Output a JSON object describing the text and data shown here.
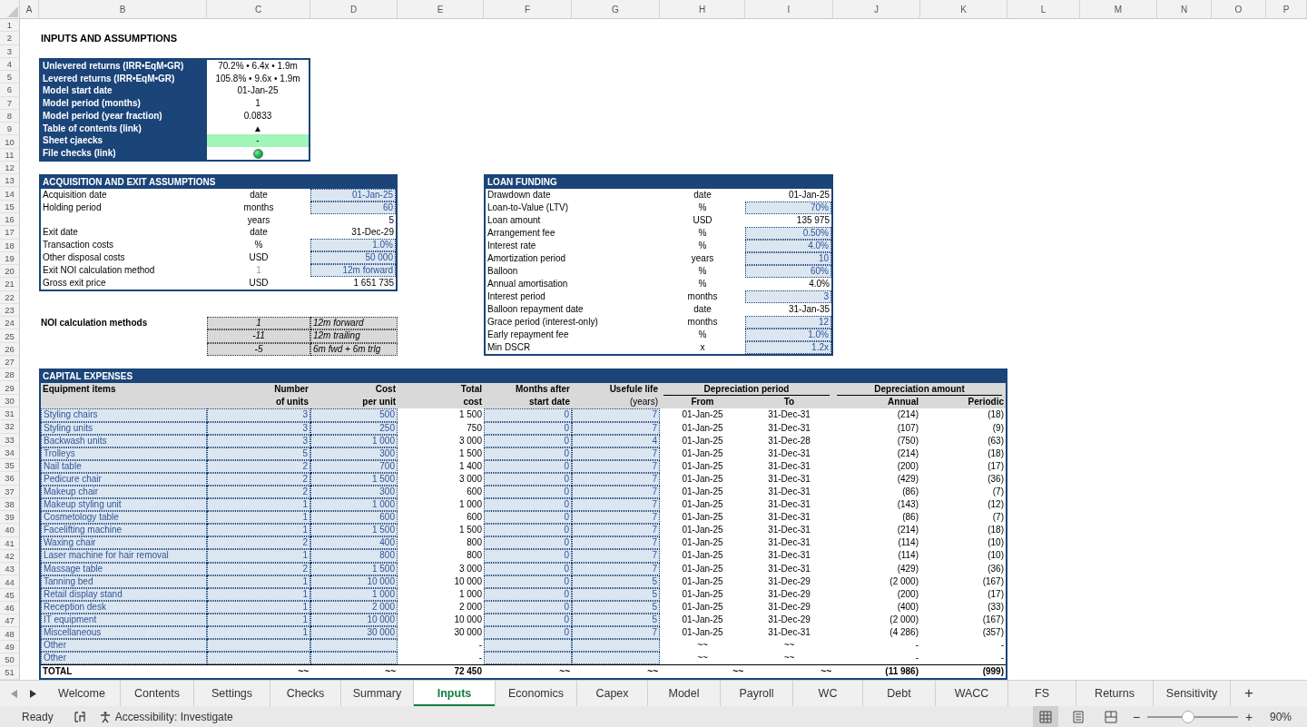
{
  "columns": [
    "A",
    "B",
    "C",
    "D",
    "E",
    "F",
    "G",
    "H",
    "I",
    "J",
    "K",
    "L",
    "M",
    "N",
    "O",
    "P"
  ],
  "rows": [
    "1",
    "2",
    "3",
    "4",
    "5",
    "6",
    "7",
    "8",
    "9",
    "10",
    "11",
    "12",
    "13",
    "14",
    "15",
    "16",
    "17",
    "18",
    "19",
    "20",
    "21",
    "22",
    "23",
    "24",
    "25",
    "26",
    "27",
    "28",
    "29",
    "30",
    "31",
    "32",
    "33",
    "34",
    "35",
    "36",
    "37",
    "38",
    "39",
    "40",
    "41",
    "42",
    "43",
    "44",
    "45",
    "46",
    "47",
    "48",
    "49",
    "50",
    "51"
  ],
  "title": "INPUTS AND ASSUMPTIONS",
  "summary": [
    {
      "label": "Unlevered returns (IRR•EqM•GR)",
      "kind": "text",
      "value": "70.2% • 6.4x • 1.9m"
    },
    {
      "label": "Levered returns (IRR•EqM•GR)",
      "kind": "text",
      "value": "105.8% • 9.6x • 1.9m"
    },
    {
      "label": "Model start date",
      "kind": "text",
      "value": "01-Jan-25"
    },
    {
      "label": "Model period (months)",
      "kind": "text",
      "value": "1"
    },
    {
      "label": "Model period (year fraction)",
      "kind": "text",
      "value": "0.0833"
    },
    {
      "label": "Table of contents (link)",
      "kind": "text",
      "value": "▲"
    },
    {
      "label": "Sheet cjaecks",
      "kind": "status",
      "value": "-",
      "ok": true
    },
    {
      "label": "File checks (link)",
      "kind": "indicator",
      "ok": true
    }
  ],
  "acquisition": {
    "title": "ACQUISITION AND EXIT ASSUMPTIONS",
    "rows": [
      {
        "label": "Acquisition date",
        "unit": "date",
        "unit_dim": false,
        "value": "01-Jan-25",
        "input": true
      },
      {
        "label": "Holding period",
        "unit": "months",
        "unit_dim": false,
        "value": "60",
        "input": true
      },
      {
        "unit": "years",
        "unit_dim": false,
        "value": "5",
        "input": false
      },
      {
        "label": "Exit date",
        "unit": "date",
        "unit_dim": false,
        "value": "31-Dec-29",
        "input": false
      },
      {
        "label": "Transaction costs",
        "unit": "%",
        "unit_dim": false,
        "value": "1.0%",
        "input": true
      },
      {
        "label": "Other disposal costs",
        "unit": "USD",
        "unit_dim": false,
        "value": "50 000",
        "input": true
      },
      {
        "label": "Exit NOI calculation method",
        "unit": "1",
        "unit_dim": true,
        "value": "12m forward",
        "input": true
      },
      {
        "label": "Gross exit price",
        "unit": "USD",
        "unit_dim": false,
        "value": "1 651 735",
        "input": false
      }
    ]
  },
  "noi_methods": {
    "label": "NOI calculation methods",
    "rows": [
      {
        "code": "1",
        "name": "12m forward"
      },
      {
        "code": "-11",
        "name": "12m trailing"
      },
      {
        "code": "-5",
        "name": "6m fwd + 6m trlg"
      }
    ]
  },
  "loan": {
    "title": "LOAN FUNDING",
    "rows": [
      {
        "label": "Drawdown date",
        "unit": "date",
        "value": "01-Jan-25",
        "input": false
      },
      {
        "label": "Loan-to-Value (LTV)",
        "unit": "%",
        "value": "70%",
        "input": true
      },
      {
        "label": "Loan amount",
        "unit": "USD",
        "value": "135 975",
        "input": false
      },
      {
        "label": "Arrangement fee",
        "unit": "%",
        "value": "0.50%",
        "input": true
      },
      {
        "label": "Interest rate",
        "unit": "%",
        "value": "4.0%",
        "input": true
      },
      {
        "label": "Amortization period",
        "unit": "years",
        "value": "10",
        "input": true
      },
      {
        "label": "Balloon",
        "unit": "%",
        "value": "60%",
        "input": true
      },
      {
        "label": "Annual amortisation",
        "unit": "%",
        "value": "4.0%",
        "input": false
      },
      {
        "label": "Interest period",
        "unit": "months",
        "value": "3",
        "input": true
      },
      {
        "label": "Balloon repayment date",
        "unit": "date",
        "value": "31-Jan-35",
        "input": false
      },
      {
        "label": "Grace period (interest-only)",
        "unit": "months",
        "value": "12",
        "input": true
      },
      {
        "label": "Early repayment fee",
        "unit": "%",
        "value": "1.0%",
        "input": true
      },
      {
        "label": "Min DSCR",
        "unit": "x",
        "value": "1.2x",
        "input": true
      }
    ]
  },
  "capex": {
    "title": "CAPITAL EXPENSES",
    "columns": [
      {
        "top": "Equipment items"
      },
      {
        "top": "Number",
        "bottom": "of units"
      },
      {
        "top": "Cost",
        "bottom": "per unit"
      },
      {
        "top": "Total",
        "bottom": "cost"
      },
      {
        "top": "Months after",
        "bottom": "start date"
      },
      {
        "top": "Usefule life",
        "bottom": "(years)"
      },
      {
        "bottom": "From"
      },
      {
        "bottom": "To"
      },
      {
        "bottom": "Annual"
      },
      {
        "bottom": "Periodic"
      }
    ],
    "groups": [
      "Depreciation period",
      "Depreciation amount"
    ],
    "items": [
      {
        "item": "Styling chairs",
        "units": "3",
        "cost": "500",
        "total": "1 500",
        "months": "0",
        "life": "7",
        "from": "01-Jan-25",
        "to": "31-Dec-31",
        "annual": "(214)",
        "periodic": "(18)"
      },
      {
        "item": "Styling units",
        "units": "3",
        "cost": "250",
        "total": "750",
        "months": "0",
        "life": "7",
        "from": "01-Jan-25",
        "to": "31-Dec-31",
        "annual": "(107)",
        "periodic": "(9)"
      },
      {
        "item": "Backwash units",
        "units": "3",
        "cost": "1 000",
        "total": "3 000",
        "months": "0",
        "life": "4",
        "from": "01-Jan-25",
        "to": "31-Dec-28",
        "annual": "(750)",
        "periodic": "(63)"
      },
      {
        "item": "Trolleys",
        "units": "5",
        "cost": "300",
        "total": "1 500",
        "months": "0",
        "life": "7",
        "from": "01-Jan-25",
        "to": "31-Dec-31",
        "annual": "(214)",
        "periodic": "(18)"
      },
      {
        "item": "Nail table",
        "units": "2",
        "cost": "700",
        "total": "1 400",
        "months": "0",
        "life": "7",
        "from": "01-Jan-25",
        "to": "31-Dec-31",
        "annual": "(200)",
        "periodic": "(17)"
      },
      {
        "item": "Pedicure chair",
        "units": "2",
        "cost": "1 500",
        "total": "3 000",
        "months": "0",
        "life": "7",
        "from": "01-Jan-25",
        "to": "31-Dec-31",
        "annual": "(429)",
        "periodic": "(36)"
      },
      {
        "item": "Makeup chair",
        "units": "2",
        "cost": "300",
        "total": "600",
        "months": "0",
        "life": "7",
        "from": "01-Jan-25",
        "to": "31-Dec-31",
        "annual": "(86)",
        "periodic": "(7)"
      },
      {
        "item": "Makeup styling unit",
        "units": "1",
        "cost": "1 000",
        "total": "1 000",
        "months": "0",
        "life": "7",
        "from": "01-Jan-25",
        "to": "31-Dec-31",
        "annual": "(143)",
        "periodic": "(12)"
      },
      {
        "item": "Cosmetology table",
        "units": "1",
        "cost": "600",
        "total": "600",
        "months": "0",
        "life": "7",
        "from": "01-Jan-25",
        "to": "31-Dec-31",
        "annual": "(86)",
        "periodic": "(7)"
      },
      {
        "item": "Facelifting machine",
        "units": "1",
        "cost": "1 500",
        "total": "1 500",
        "months": "0",
        "life": "7",
        "from": "01-Jan-25",
        "to": "31-Dec-31",
        "annual": "(214)",
        "periodic": "(18)"
      },
      {
        "item": "Waxing chair",
        "units": "2",
        "cost": "400",
        "total": "800",
        "months": "0",
        "life": "7",
        "from": "01-Jan-25",
        "to": "31-Dec-31",
        "annual": "(114)",
        "periodic": "(10)"
      },
      {
        "item": "Laser machine for hair removal",
        "units": "1",
        "cost": "800",
        "total": "800",
        "months": "0",
        "life": "7",
        "from": "01-Jan-25",
        "to": "31-Dec-31",
        "annual": "(114)",
        "periodic": "(10)"
      },
      {
        "item": "Massage table",
        "units": "2",
        "cost": "1 500",
        "total": "3 000",
        "months": "0",
        "life": "7",
        "from": "01-Jan-25",
        "to": "31-Dec-31",
        "annual": "(429)",
        "periodic": "(36)"
      },
      {
        "item": "Tanning bed",
        "units": "1",
        "cost": "10 000",
        "total": "10 000",
        "months": "0",
        "life": "5",
        "from": "01-Jan-25",
        "to": "31-Dec-29",
        "annual": "(2 000)",
        "periodic": "(167)"
      },
      {
        "item": "Retail display stand",
        "units": "1",
        "cost": "1 000",
        "total": "1 000",
        "months": "0",
        "life": "5",
        "from": "01-Jan-25",
        "to": "31-Dec-29",
        "annual": "(200)",
        "periodic": "(17)"
      },
      {
        "item": "Reception desk",
        "units": "1",
        "cost": "2 000",
        "total": "2 000",
        "months": "0",
        "life": "5",
        "from": "01-Jan-25",
        "to": "31-Dec-29",
        "annual": "(400)",
        "periodic": "(33)"
      },
      {
        "item": "IT equipment",
        "units": "1",
        "cost": "10 000",
        "total": "10 000",
        "months": "0",
        "life": "5",
        "from": "01-Jan-25",
        "to": "31-Dec-29",
        "annual": "(2 000)",
        "periodic": "(167)"
      },
      {
        "item": "Miscellaneous",
        "units": "1",
        "cost": "30 000",
        "total": "30 000",
        "months": "0",
        "life": "7",
        "from": "01-Jan-25",
        "to": "31-Dec-31",
        "annual": "(4 286)",
        "periodic": "(357)"
      },
      {
        "item": "Other",
        "total": "-",
        "from": "~~",
        "to": "~~",
        "annual": "-",
        "periodic": "-"
      },
      {
        "item": "Other",
        "total": "-",
        "from": "~~",
        "to": "~~",
        "annual": "-",
        "periodic": "-"
      }
    ],
    "total": {
      "item": "TOTAL",
      "units": "~~",
      "cost": "~~",
      "total": "72 450",
      "months": "~~",
      "life": "~~",
      "from": "~~",
      "to": "~~",
      "annual": "(11 986)",
      "periodic": "(999)"
    }
  },
  "tabs": [
    {
      "label": "Welcome",
      "selected": false
    },
    {
      "label": "Contents",
      "selected": false
    },
    {
      "label": "Settings",
      "selected": false
    },
    {
      "label": "Checks",
      "selected": false
    },
    {
      "label": "Summary",
      "selected": false
    },
    {
      "label": "Inputs",
      "selected": true
    },
    {
      "label": "Economics",
      "selected": false
    },
    {
      "label": "Capex",
      "selected": false
    },
    {
      "label": "Model",
      "selected": false
    },
    {
      "label": "Payroll",
      "selected": false
    },
    {
      "label": "WC",
      "selected": false
    },
    {
      "label": "Debt",
      "selected": false
    },
    {
      "label": "WACC",
      "selected": false
    },
    {
      "label": "FS",
      "selected": false
    },
    {
      "label": "Returns",
      "selected": false
    },
    {
      "label": "Sensitivity",
      "selected": false
    }
  ],
  "add_sheet": "+",
  "status_bar": {
    "mode": "Ready",
    "accessibility": "Accessibility: Investigate",
    "views": [
      {
        "kind": "normal",
        "selected": true
      },
      {
        "kind": "page-layout",
        "selected": false
      },
      {
        "kind": "page-break",
        "selected": false
      }
    ],
    "zoom_out": "−",
    "zoom_in": "+",
    "zoom": {
      "level": 0.45,
      "reading": "90%"
    }
  }
}
